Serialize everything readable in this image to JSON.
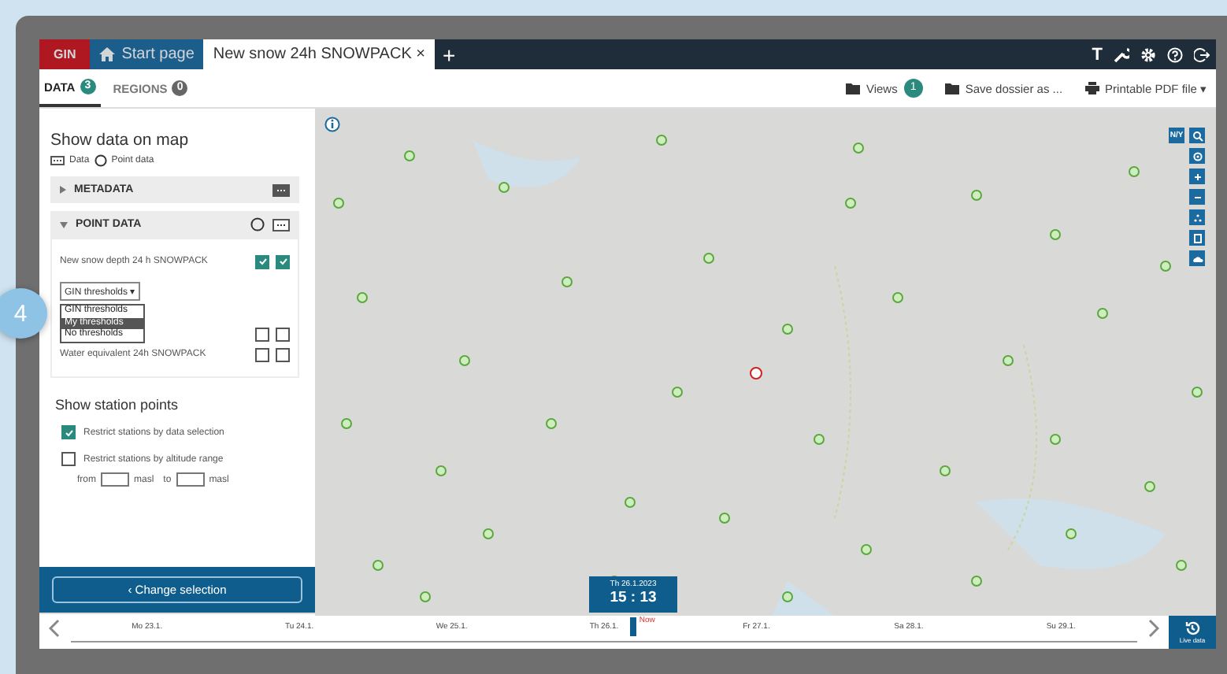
{
  "step_badge": "4",
  "tabs": [
    {
      "kind": "brand",
      "label": "GIN",
      "selected": false
    },
    {
      "kind": "home",
      "label": "Start page",
      "selected": false
    },
    {
      "kind": "doc",
      "label": "New snow 24h SNOWPACK",
      "close": "×",
      "selected": true
    }
  ],
  "new_tab": "+",
  "top_icons": [
    {
      "kind": "text",
      "label": "T"
    },
    {
      "kind": "wrench"
    },
    {
      "kind": "gear"
    },
    {
      "kind": "help"
    },
    {
      "kind": "logout"
    }
  ],
  "subtabs": [
    {
      "label": "DATA",
      "count": "3",
      "selected": true
    },
    {
      "label": "REGIONS",
      "count": "0",
      "selected": false
    }
  ],
  "toolbar": {
    "views": "Views",
    "views_count": "1",
    "save": "Save dossier as ...",
    "print": "Printable PDF file",
    "print_caret": "▾"
  },
  "sidebar": {
    "title": "Show data on map",
    "legend": [
      {
        "kind": "data",
        "label": "Data"
      },
      {
        "kind": "point",
        "label": "Point data"
      }
    ],
    "sections": [
      {
        "title": "METADATA",
        "expanded": false
      },
      {
        "title": "POINT DATA",
        "expanded": true
      }
    ],
    "rows": [
      {
        "label": "New snow depth 24 h SNOWPACK",
        "data": true,
        "point": true
      },
      {
        "data": false,
        "point": false
      },
      {
        "label": "Water equivalent 24h SNOWPACK",
        "data": false,
        "point": false
      }
    ],
    "dropdown": {
      "value": "GIN thresholds",
      "caret": "▾",
      "options": [
        {
          "label": "GIN thresholds",
          "highlighted": false
        },
        {
          "label": "My thresholds",
          "highlighted": true
        },
        {
          "label": "No thresholds",
          "highlighted": false
        }
      ]
    },
    "stations_title": "Show station points",
    "restrict_data": {
      "label": "Restrict stations by data selection",
      "checked": true
    },
    "restrict_altitude": {
      "label": "Restrict stations by altitude range",
      "checked": false,
      "from": "from",
      "unit1": "masl",
      "to": "to",
      "unit2": "masl"
    },
    "change_button": "‹ Change selection"
  },
  "map": {
    "controls": [
      {
        "kind": "text",
        "label": "N/Y"
      },
      {
        "kind": "search"
      },
      {
        "kind": "target"
      },
      {
        "kind": "plus"
      },
      {
        "kind": "minus"
      },
      {
        "kind": "dots"
      },
      {
        "kind": "page"
      },
      {
        "kind": "cloud"
      }
    ]
  },
  "timeline": {
    "days": [
      "Mo 23.1.",
      "Tu 24.1.",
      "We 25.1.",
      "Th 26.1.",
      "Fr 27.1.",
      "Sa 28.1.",
      "Su 29.1."
    ],
    "now": "Now",
    "date": "Th 26.1.2023",
    "time": "15 : 13",
    "live": "Live data"
  }
}
